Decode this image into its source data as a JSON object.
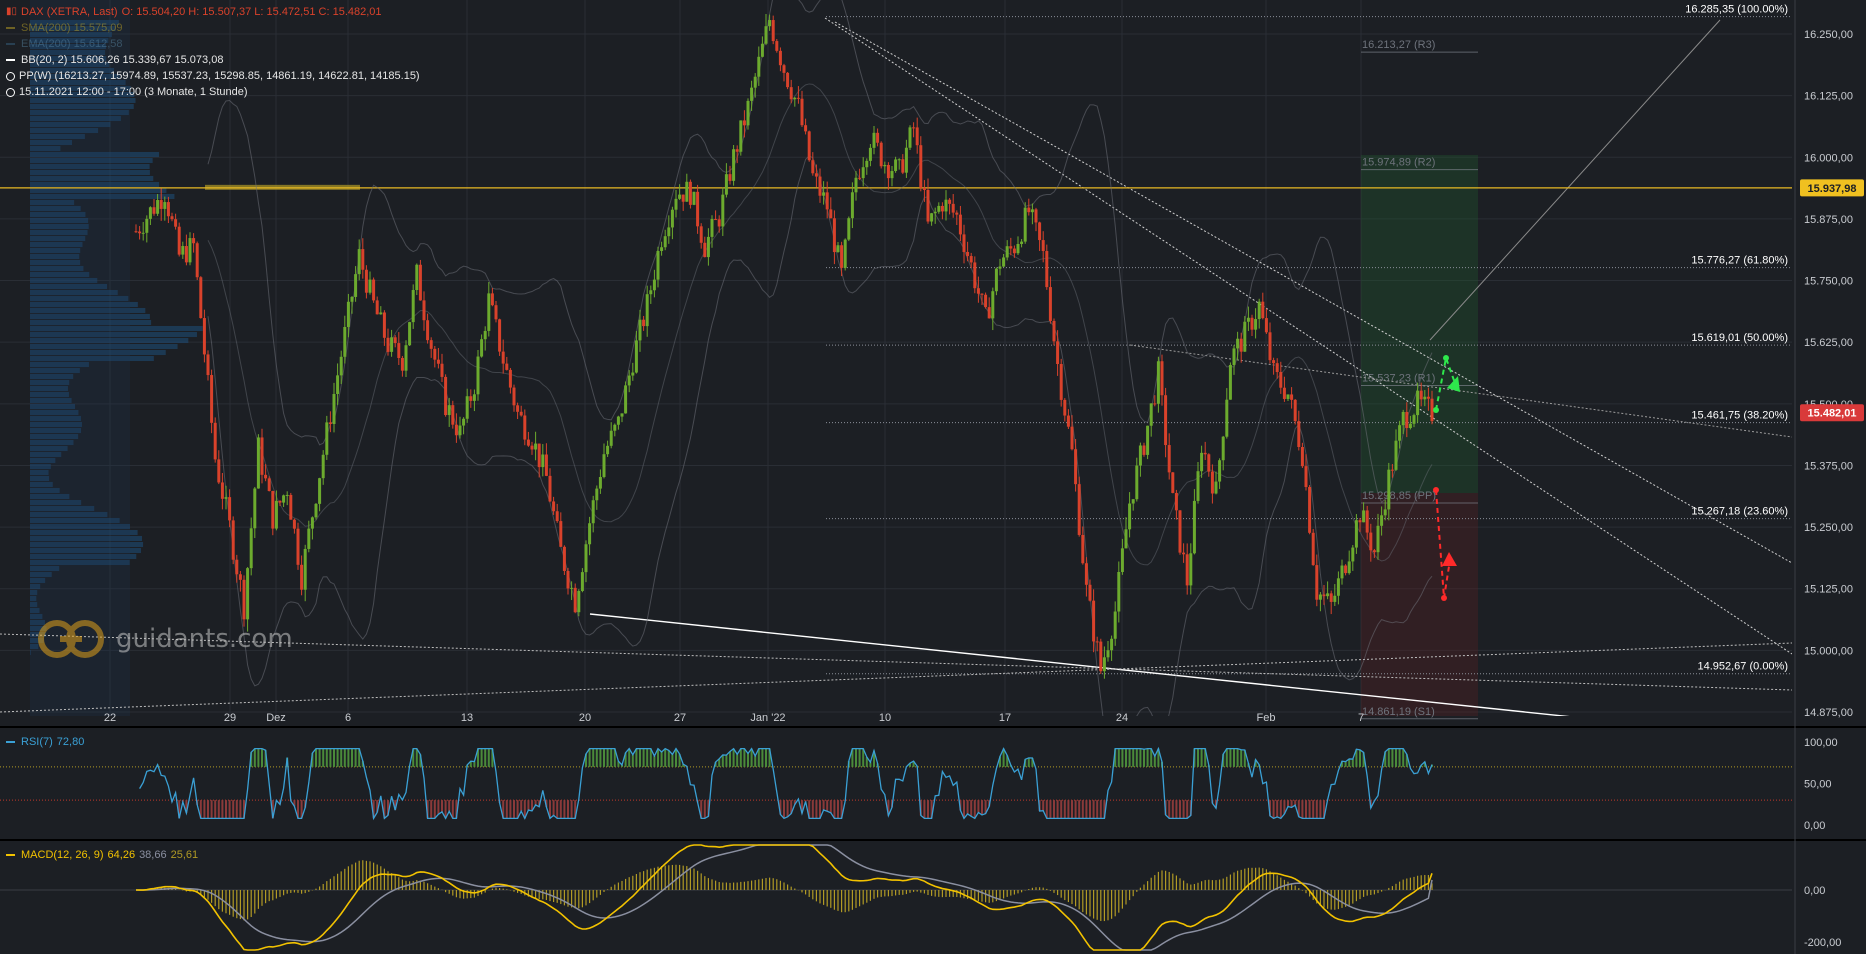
{
  "header": {
    "instrument": "DAX (XETRA, Last)",
    "ohlc": "O: 15.504,20  H: 15.507,37  L: 15.472,51  C: 15.482,01",
    "sma": "SMA(200)  15.575,09",
    "ema": "EMA(200)  15.612,58",
    "bb": "BB(20, 2)  15.606,26  15.339,67  15.073,08",
    "pp": "PP(W)  (16213.27, 15974.89, 15537.23, 15298.85, 14861.19, 14622.81, 14185.15)",
    "period": "15.11.2021 12:00 - 17:00  (3 Monate, 1 Stunde)"
  },
  "colors": {
    "background": "#1c1f24",
    "up": "#6cab2e",
    "down": "#d9422b",
    "rsi": "#3aa0d5",
    "macd": "#f2c200",
    "signal": "#8a8fa0",
    "histogram": "#b19a25",
    "price_tag": "#d93a3a",
    "level_tag": "#f0c020",
    "volume_profile": "#1d4f7a"
  },
  "logo": {
    "text": "guidants.com",
    "icon": "guidants-logo-icon"
  },
  "chart_data": [
    {
      "type": "candlestick",
      "title": "DAX (XETRA, Last)",
      "interval": "1 Stunde",
      "y_ticks": [
        "16.250,00",
        "16.125,00",
        "16.000,00",
        "15.875,00",
        "15.750,00",
        "15.625,00",
        "15.500,00",
        "15.375,00",
        "15.250,00",
        "15.125,00",
        "15.000,00",
        "14.875,00"
      ],
      "ylim": [
        14840,
        16300
      ],
      "x_ticks": [
        "22",
        "29",
        "Dez",
        "6",
        "13",
        "20",
        "27",
        "Jan '22",
        "10",
        "17",
        "24",
        "Feb",
        "7"
      ],
      "last_price": {
        "label": "15.482,01",
        "value": 15482.01
      },
      "horizontal_level": {
        "label": "15.937,98",
        "value": 15937.98
      },
      "fibonacci": [
        {
          "label": "16.285,35 (100.00%)",
          "value": 16285.35
        },
        {
          "label": "15.776,27 (61.80%)",
          "value": 15776.27
        },
        {
          "label": "15.619,01 (50.00%)",
          "value": 15619.01
        },
        {
          "label": "15.461,75 (38.20%)",
          "value": 15461.75
        },
        {
          "label": "15.267,18 (23.60%)",
          "value": 15267.18
        },
        {
          "label": "14.952,67 (0.00%)",
          "value": 14952.67
        }
      ],
      "pivots": [
        {
          "label": "16.213,27 (R3)",
          "value": 16213.27
        },
        {
          "label": "15.974,89 (R2)",
          "value": 15974.89
        },
        {
          "label": "15.537,23 (R1)",
          "value": 15537.23
        },
        {
          "label": "15.298,85 (PP)",
          "value": 15298.85
        },
        {
          "label": "14.861,19 (S1)",
          "value": 14861.19
        }
      ],
      "path": [
        [
          0,
          15850
        ],
        [
          4,
          15930
        ],
        [
          6,
          15800
        ],
        [
          8,
          15820
        ],
        [
          11,
          15390
        ],
        [
          13,
          15250
        ],
        [
          15,
          15090
        ],
        [
          17,
          15410
        ],
        [
          19,
          15270
        ],
        [
          21,
          15330
        ],
        [
          23,
          15150
        ],
        [
          25,
          15320
        ],
        [
          27,
          15480
        ],
        [
          29,
          15640
        ],
        [
          31,
          15800
        ],
        [
          33,
          15700
        ],
        [
          35,
          15620
        ],
        [
          37,
          15590
        ],
        [
          39,
          15760
        ],
        [
          41,
          15620
        ],
        [
          43,
          15500
        ],
        [
          45,
          15440
        ],
        [
          47,
          15540
        ],
        [
          49,
          15710
        ],
        [
          51,
          15590
        ],
        [
          53,
          15480
        ],
        [
          55,
          15430
        ],
        [
          57,
          15350
        ],
        [
          59,
          15200
        ],
        [
          61,
          15100
        ],
        [
          63,
          15260
        ],
        [
          65,
          15400
        ],
        [
          67,
          15460
        ],
        [
          69,
          15590
        ],
        [
          71,
          15700
        ],
        [
          73,
          15840
        ],
        [
          75,
          15930
        ],
        [
          77,
          15930
        ],
        [
          79,
          15820
        ],
        [
          81,
          15880
        ],
        [
          83,
          16000
        ],
        [
          85,
          16100
        ],
        [
          87,
          16220
        ],
        [
          88,
          16280
        ],
        [
          90,
          16180
        ],
        [
          92,
          16100
        ],
        [
          94,
          15960
        ],
        [
          96,
          15900
        ],
        [
          98,
          15760
        ],
        [
          100,
          15960
        ],
        [
          102,
          16040
        ],
        [
          104,
          15990
        ],
        [
          106,
          15970
        ],
        [
          108,
          16060
        ],
        [
          110,
          15860
        ],
        [
          112,
          15910
        ],
        [
          114,
          15880
        ],
        [
          116,
          15780
        ],
        [
          118,
          15670
        ],
        [
          120,
          15790
        ],
        [
          122,
          15820
        ],
        [
          124,
          15890
        ],
        [
          126,
          15800
        ],
        [
          128,
          15580
        ],
        [
          130,
          15400
        ],
        [
          132,
          15120
        ],
        [
          134,
          14960
        ],
        [
          136,
          15080
        ],
        [
          138,
          15300
        ],
        [
          140,
          15420
        ],
        [
          142,
          15560
        ],
        [
          144,
          15300
        ],
        [
          146,
          15140
        ],
        [
          148,
          15420
        ],
        [
          150,
          15320
        ],
        [
          152,
          15590
        ],
        [
          154,
          15640
        ],
        [
          156,
          15700
        ],
        [
          158,
          15560
        ],
        [
          160,
          15520
        ],
        [
          162,
          15400
        ],
        [
          164,
          15120
        ],
        [
          166,
          15090
        ],
        [
          168,
          15180
        ],
        [
          170,
          15280
        ],
        [
          172,
          15200
        ],
        [
          174,
          15350
        ],
        [
          176,
          15470
        ],
        [
          178,
          15500
        ],
        [
          180,
          15482
        ]
      ],
      "bollinger_bands": {
        "upper": 15606.26,
        "middle": 15339.67,
        "lower": 15073.08
      },
      "moving_averages": [
        {
          "name": "SMA(200)",
          "value": 15575.09
        },
        {
          "name": "EMA(200)",
          "value": 15612.58
        }
      ]
    },
    {
      "type": "line",
      "title": "RSI(7)",
      "series": [
        {
          "name": "RSI(7)",
          "last": 72.8
        }
      ],
      "last_label": "72,80",
      "y_ticks": [
        "100,00",
        "50,00",
        "0,00"
      ],
      "ylim": [
        0,
        100
      ],
      "thresholds": [
        70,
        30
      ]
    },
    {
      "type": "line",
      "title": "MACD(12, 26, 9)",
      "series": [
        {
          "name": "MACD",
          "last": 64.26
        },
        {
          "name": "Signal",
          "last": 38.66
        },
        {
          "name": "Histogram",
          "last": 25.61
        }
      ],
      "legend_values": [
        "64,26",
        "38,66",
        "25,61"
      ],
      "y_ticks": [
        "0,00",
        "-200,00"
      ],
      "ylim": [
        -200,
        200
      ]
    }
  ]
}
